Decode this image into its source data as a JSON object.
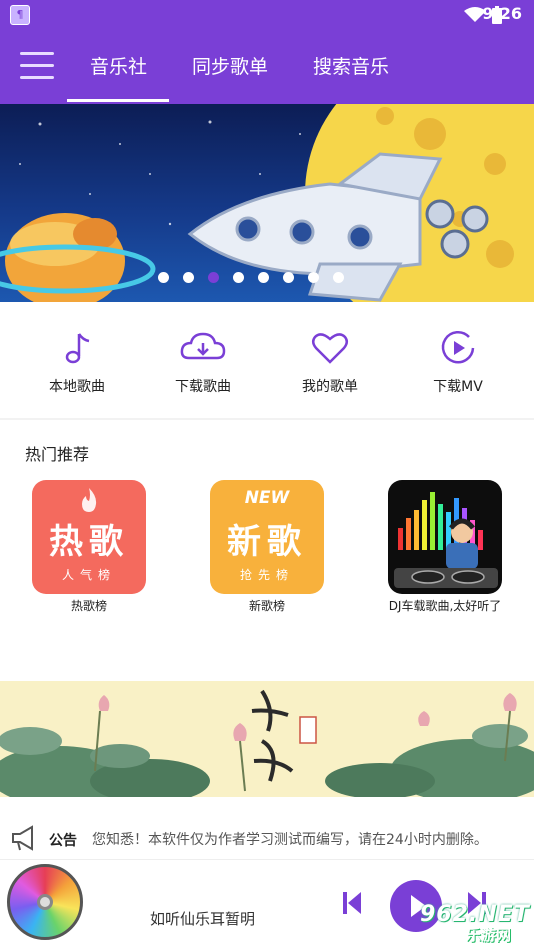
{
  "status_bar": {
    "time": "9:26",
    "app_icon_glyph": "¶"
  },
  "header": {
    "tabs": [
      {
        "label": "音乐社",
        "active": true
      },
      {
        "label": "同步歌单",
        "active": false
      },
      {
        "label": "搜索音乐",
        "active": false
      }
    ]
  },
  "banner": {
    "dot_count": 8,
    "active_index": 2
  },
  "quick_actions": [
    {
      "label": "本地歌曲",
      "icon": "music-note-icon"
    },
    {
      "label": "下载歌曲",
      "icon": "cloud-download-icon"
    },
    {
      "label": "我的歌单",
      "icon": "heart-icon"
    },
    {
      "label": "下载MV",
      "icon": "play-circle-icon"
    }
  ],
  "recommend": {
    "title": "热门推荐",
    "items": [
      {
        "caption": "热歌榜",
        "tile_big": "热歌",
        "tile_small": "人气榜"
      },
      {
        "caption": "新歌榜",
        "tile_big": "新歌",
        "tile_small": "抢先榜",
        "tile_badge": "NEW"
      },
      {
        "caption": "DJ车载歌曲,太好听了"
      }
    ]
  },
  "lotus_banner": {
    "calligraphy": "西施",
    "seal": "工笔画"
  },
  "notice": {
    "title": "公告",
    "text": "您知悉！本软件仅为作者学习测试而编写，请在24小时内删除。"
  },
  "player": {
    "song": "如听仙乐耳暂明"
  },
  "watermark": {
    "line1": "962.NET",
    "line2": "乐游网"
  },
  "colors": {
    "primary": "#7a3fd6",
    "hot": "#f46a5e",
    "new": "#f8b13c"
  }
}
